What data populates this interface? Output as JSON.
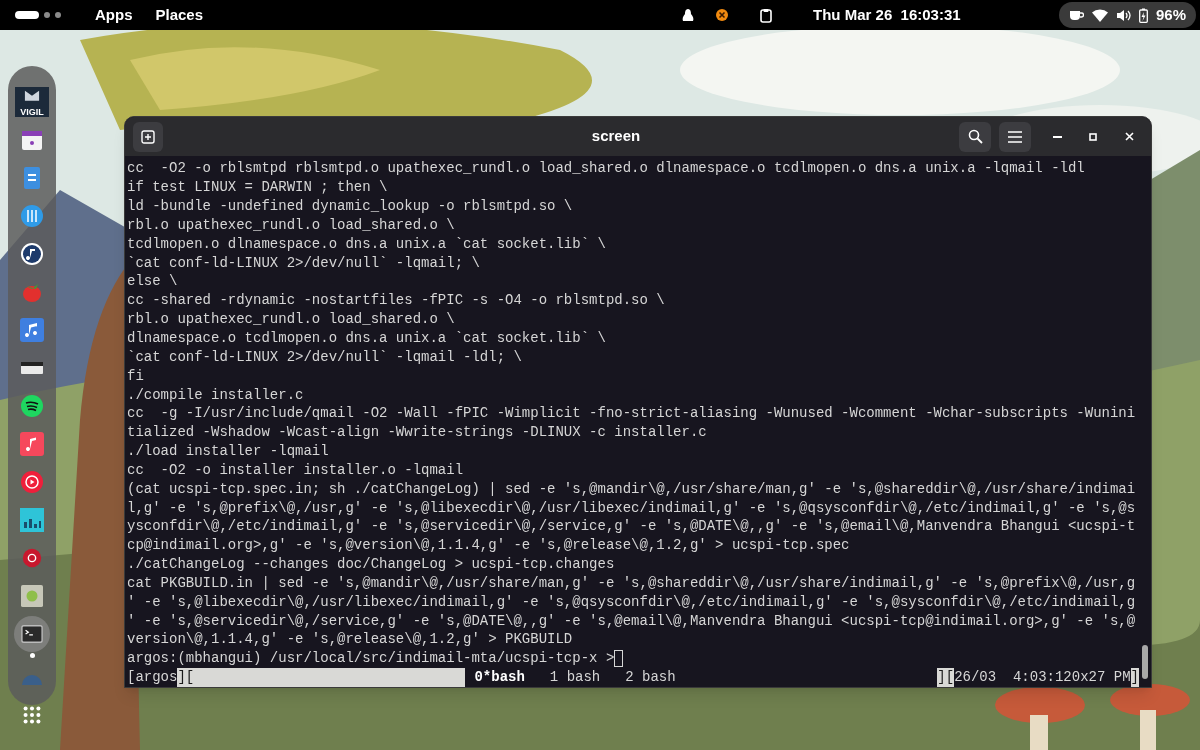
{
  "top_bar": {
    "workspaces": [
      {
        "selected": true
      },
      {
        "selected": false
      },
      {
        "selected": false
      }
    ],
    "menus": [
      "Apps",
      "Places"
    ],
    "clock": "Thu Mar 26  16:03:31",
    "battery": "96%"
  },
  "dock": {
    "items": [
      {
        "label": "VIGIL",
        "selected": false
      },
      {
        "selected": false
      },
      {
        "selected": false
      },
      {
        "selected": false
      },
      {
        "selected": false
      },
      {
        "selected": false
      },
      {
        "selected": false
      },
      {
        "selected": false
      },
      {
        "selected": false
      },
      {
        "selected": false
      },
      {
        "selected": false
      },
      {
        "selected": false
      },
      {
        "selected": false
      },
      {
        "selected": false
      },
      {
        "selected": true
      },
      {
        "selected": false
      },
      {
        "selected": false
      }
    ]
  },
  "window": {
    "title": "screen",
    "lines": [
      "cc  -O2 -o rblsmtpd rblsmtpd.o upathexec_rundl.o load_shared.o dlnamespace.o tcdlmopen.o dns.a unix.a -lqmail -ldl",
      "if test LINUX = DARWIN ; then \\",
      "ld -bundle -undefined dynamic_lookup -o rblsmtpd.so \\",
      "rbl.o upathexec_rundl.o load_shared.o \\",
      "tcdlmopen.o dlnamespace.o dns.a unix.a `cat socket.lib` \\",
      "`cat conf-ld-LINUX 2>/dev/null` -lqmail; \\",
      "else \\",
      "cc -shared -rdynamic -nostartfiles -fPIC -s -O4 -o rblsmtpd.so \\",
      "rbl.o upathexec_rundl.o load_shared.o \\",
      "dlnamespace.o tcdlmopen.o dns.a unix.a `cat socket.lib` \\",
      "`cat conf-ld-LINUX 2>/dev/null` -lqmail -ldl; \\",
      "fi",
      "./compile installer.c",
      "cc  -g -I/usr/include/qmail -O2 -Wall -fPIC -Wimplicit -fno-strict-aliasing -Wunused -Wcomment -Wchar-subscripts -Wunini",
      "tialized -Wshadow -Wcast-align -Wwrite-strings -DLINUX -c installer.c",
      "./load installer -lqmail",
      "cc  -O2 -o installer installer.o -lqmail",
      "(cat ucspi-tcp.spec.in; sh ./catChangeLog) | sed -e 's,@mandir\\@,/usr/share/man,g' -e 's,@shareddir\\@,/usr/share/indimai",
      "l,g' -e 's,@prefix\\@,/usr,g' -e 's,@libexecdir\\@,/usr/libexec/indimail,g' -e 's,@qsysconfdir\\@,/etc/indimail,g' -e 's,@s",
      "ysconfdir\\@,/etc/indimail,g' -e 's,@servicedir\\@,/service,g' -e 's,@DATE\\@,,g' -e 's,@email\\@,Manvendra Bhangui <ucspi-t",
      "cp@indimail.org>,g' -e 's,@version\\@,1.1.4,g' -e 's,@release\\@,1.2,g' > ucspi-tcp.spec",
      "./catChangeLog --changes doc/ChangeLog > ucspi-tcp.changes",
      "cat PKGBUILD.in | sed -e 's,@mandir\\@,/usr/share/man,g' -e 's,@shareddir\\@,/usr/share/indimail,g' -e 's,@prefix\\@,/usr,g",
      "' -e 's,@libexecdir\\@,/usr/libexec/indimail,g' -e 's,@qsysconfdir\\@,/etc/indimail,g' -e 's,@sysconfdir\\@,/etc/indimail,g",
      "' -e 's,@servicedir\\@,/service,g' -e 's,@DATE\\@,,g' -e 's,@email\\@,Manvendra Bhangui <ucspi-tcp@indimail.org>,g' -e 's,@",
      "version\\@,1.1.4,g' -e 's,@release\\@,1.2,g' > PKGBUILD"
    ],
    "prompt": "argos:(mbhangui) /usr/local/src/indimail-mta/ucspi-tcp-x >",
    "status_line": {
      "left": [
        {
          "text": "[argos",
          "inverse": false
        },
        {
          "text": "][",
          "inverse": true
        }
      ],
      "windows": [
        {
          "label": "0*bash",
          "selected": true
        },
        {
          "label": "1 bash",
          "selected": false
        },
        {
          "label": "2 bash",
          "selected": false
        }
      ],
      "right": [
        {
          "text": "][",
          "inverse": true
        },
        {
          "text": "26/03  4:03:120x27 PM",
          "inverse": false
        },
        {
          "text": "]",
          "inverse": true
        }
      ]
    }
  }
}
